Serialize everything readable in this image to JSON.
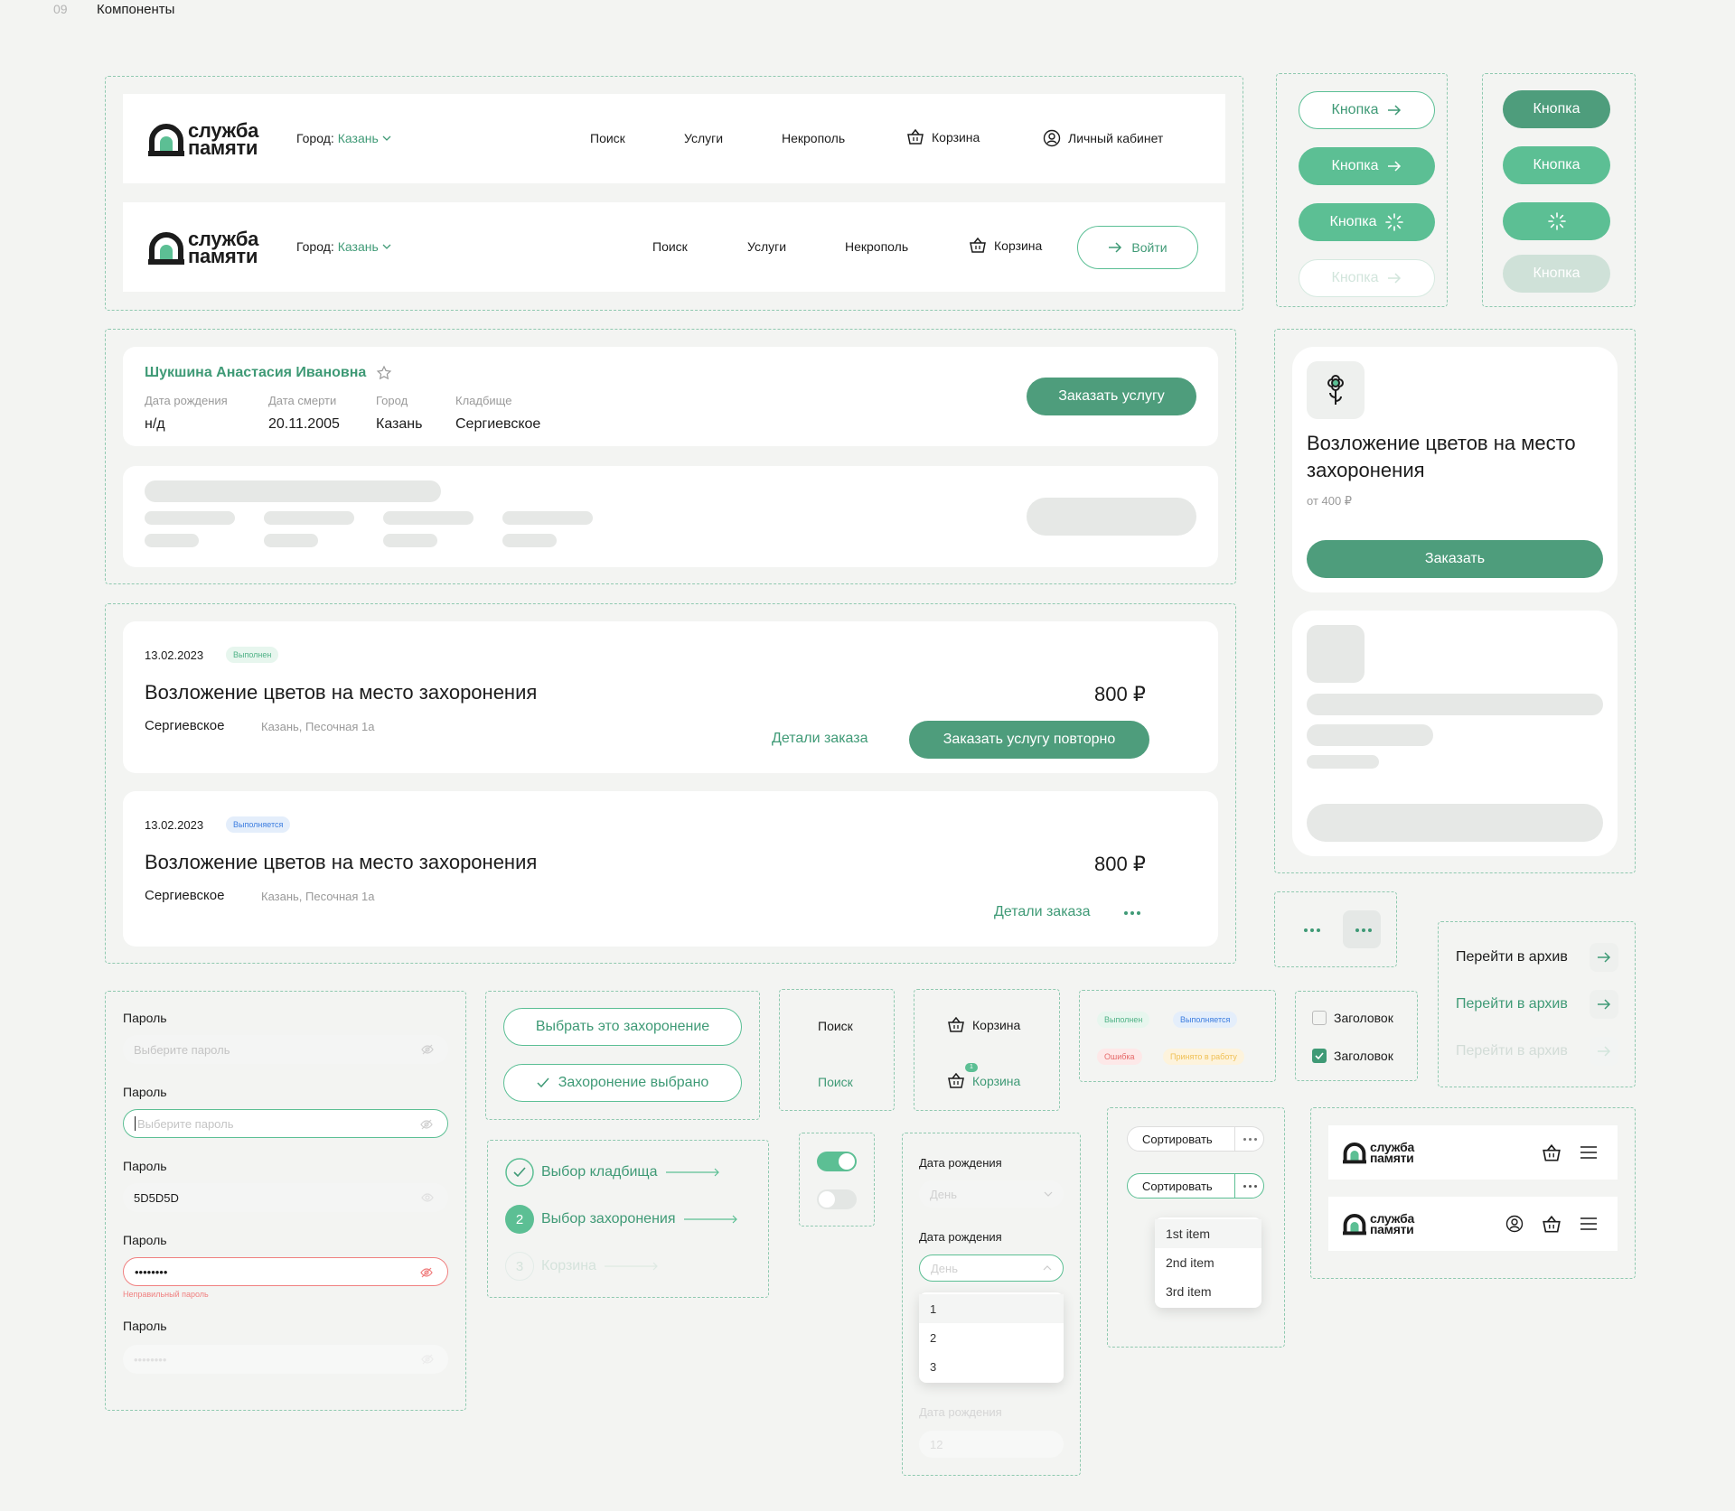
{
  "page": {
    "number": "09",
    "title": "Компоненты"
  },
  "colors": {
    "accent": "#5cbf94",
    "accent_dark": "#4e9d7c",
    "text_green": "#3f9a76",
    "error": "#f08080",
    "blue_tag": "#3d7ee0"
  },
  "header": {
    "logo_line1": "служба",
    "logo_line2": "памяти",
    "city_label": "Город:",
    "city_value": "Казань",
    "nav": [
      "Поиск",
      "Услуги",
      "Некрополь"
    ],
    "cart": "Корзина",
    "account": "Личный кабинет",
    "login": "Войти"
  },
  "buttons": {
    "label": "Кнопка"
  },
  "grave_card": {
    "name": "Шукшина Анастасия Ивановна",
    "birth_label": "Дата рождения",
    "birth_value": "н/д",
    "death_label": "Дата смерти",
    "death_value": "20.11.2005",
    "city_label": "Город",
    "city_value": "Казань",
    "cemetery_label": "Кладбище",
    "cemetery_value": "Сергиевское",
    "order_button": "Заказать услугу"
  },
  "service_card": {
    "title": "Возложение цветов на место захоронения",
    "price": "от 400 ₽",
    "order_button": "Заказать"
  },
  "orders": [
    {
      "date": "13.02.2023",
      "status": "Выполнен",
      "title": "Возложение цветов на место захоронения",
      "price": "800 ₽",
      "cemetery": "Сергиевское",
      "address": "Казань, Песочная 1а",
      "details": "Детали заказа",
      "repeat": "Заказать услугу повторно"
    },
    {
      "date": "13.02.2023",
      "status": "Выполняется",
      "title": "Возложение цветов на место захоронения",
      "price": "800 ₽",
      "cemetery": "Сергиевское",
      "address": "Казань, Песочная 1а",
      "details": "Детали заказа"
    }
  ],
  "archive": {
    "label": "Перейти в архив"
  },
  "password_fields": [
    {
      "label": "Пароль",
      "placeholder": "Выберите пароль",
      "value": ""
    },
    {
      "label": "Пароль",
      "placeholder": "Выберите пароль",
      "value": ""
    },
    {
      "label": "Пароль",
      "placeholder": "",
      "value": "5D5D5D"
    },
    {
      "label": "Пароль",
      "placeholder": "",
      "value": "••••••••",
      "error": "Неправильный пароль"
    },
    {
      "label": "Пароль",
      "placeholder": "",
      "value": "••••••••"
    }
  ],
  "choose_buttons": {
    "select": "Выбрать это захоронение",
    "selected": "Захоронение выбрано"
  },
  "steps": [
    {
      "number": "",
      "label": "Выбор кладбища"
    },
    {
      "number": "2",
      "label": "Выбор захоронения"
    },
    {
      "number": "3",
      "label": "Корзина"
    }
  ],
  "links": {
    "search": "Поиск",
    "cart": "Корзина",
    "cart_count": "1"
  },
  "tags": {
    "done": "Выполнен",
    "in_progress": "Выполняется",
    "error": "Ошибка",
    "accepted": "Принято в работу"
  },
  "checkboxes": {
    "label": "Заголовок"
  },
  "date_fields": {
    "label": "Дата рождения",
    "placeholder": "День",
    "options": [
      "1",
      "2",
      "3"
    ],
    "disabled_value": "12"
  },
  "sort": {
    "label": "Сортировать",
    "items": [
      "1st item",
      "2nd item",
      "3rd item"
    ]
  }
}
